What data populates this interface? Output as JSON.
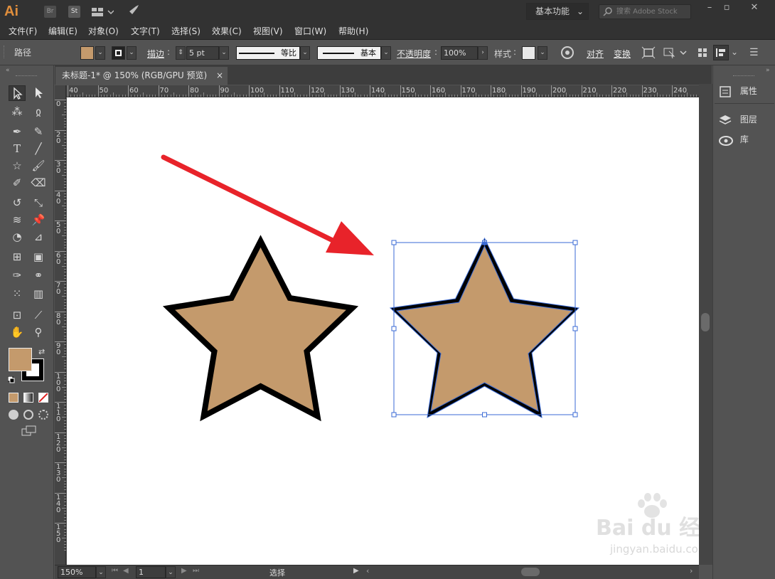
{
  "app": {
    "logo": "Ai",
    "bridge": "Br",
    "stock": "St",
    "workspace": "基本功能",
    "search_placeholder": "搜索 Adobe Stock"
  },
  "menu": [
    "文件(F)",
    "编辑(E)",
    "对象(O)",
    "文字(T)",
    "选择(S)",
    "效果(C)",
    "视图(V)",
    "窗口(W)",
    "帮助(H)"
  ],
  "control": {
    "object_type": "路径",
    "fill_color": "#c49a6c",
    "stroke_label": "描边",
    "stroke_weight": "5 pt",
    "stroke_profile": "等比",
    "brush": "基本",
    "opacity_label": "不透明度",
    "opacity_value": "100%",
    "style_label": "样式",
    "align_label": "对齐",
    "transform_label": "变换"
  },
  "document": {
    "tab_title": "未标题-1* @ 150% (RGB/GPU 预览)",
    "close_glyph": "×"
  },
  "ruler": {
    "top_ticks": [
      "40",
      "50",
      "60",
      "70",
      "80",
      "90",
      "100",
      "110",
      "120",
      "130",
      "140",
      "150",
      "160",
      "170",
      "180",
      "190",
      "200",
      "210",
      "220",
      "230",
      "240"
    ],
    "left_ticks": [
      "0",
      "2 0",
      "3 0",
      "4 0",
      "5 0",
      "6 0",
      "7 0",
      "8 0",
      "9 0",
      "1 0 0",
      "1 1 0",
      "1 2 0",
      "1 3 0",
      "1 4 0",
      "1 5 0"
    ]
  },
  "panels": {
    "properties": "属性",
    "layers": "图层",
    "libraries": "库"
  },
  "status": {
    "zoom": "150%",
    "artboard": "1",
    "tool": "选择"
  },
  "colors": {
    "star_fill": "#c49a6c",
    "selection": "#3a6ad4",
    "arrow": "#e8232a",
    "accent_logo": "#e08e3c"
  },
  "watermark": {
    "brand": "Bai du 经验",
    "url": "jingyan.baidu.com"
  }
}
